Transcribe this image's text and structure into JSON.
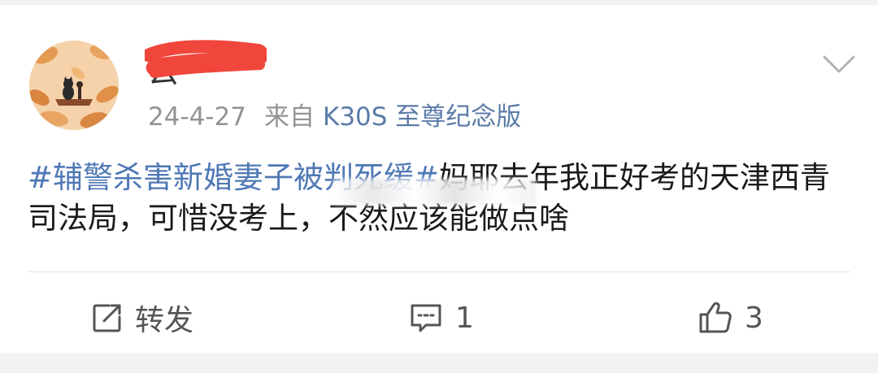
{
  "post": {
    "username_visible": "云",
    "date": "24-4-27",
    "from_label": "来自",
    "device": "K30S 至尊纪念版",
    "hashtag": "#辅警杀害新婚妻子被判死缓#",
    "body": "妈耶去年我正好考的天津西青司法局，可惜没考上，不然应该能做点啥"
  },
  "actions": {
    "repost_label": "转发",
    "comment_count": "1",
    "like_count": "3"
  },
  "colors": {
    "link_blue": "#4f78b5",
    "meta_gray": "#939393",
    "redaction_red": "#f0463c"
  },
  "icons": [
    "chevron-down-icon",
    "repost-icon",
    "comment-icon",
    "like-icon"
  ]
}
